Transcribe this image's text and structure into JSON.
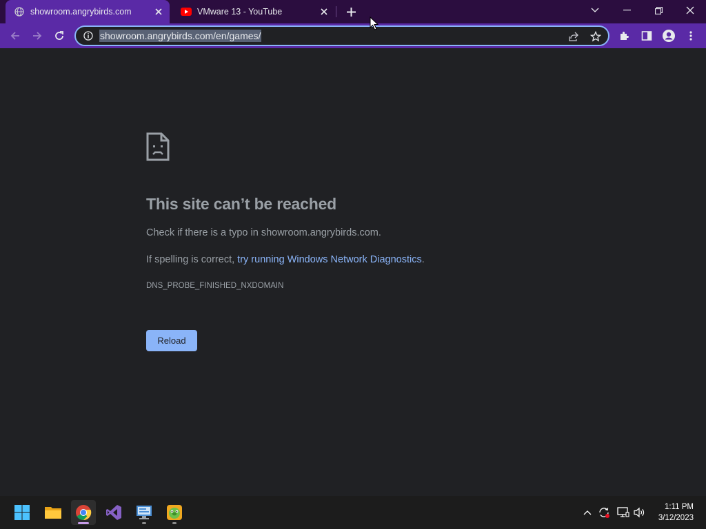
{
  "browser": {
    "tabs": [
      {
        "title": "showroom.angrybirds.com",
        "favicon": "globe-icon",
        "active": true
      },
      {
        "title": "VMware 13 - YouTube",
        "favicon": "youtube-icon",
        "active": false
      }
    ],
    "new_tab_icon": "plus-icon",
    "window_controls": [
      "tab-search-icon",
      "minimize-icon",
      "restore-icon",
      "close-icon"
    ],
    "toolbar": {
      "back_icon": "back-arrow-icon",
      "forward_icon": "forward-arrow-icon",
      "reload_icon": "reload-icon",
      "url": "showroom.angrybirds.com/en/games/",
      "site_info_icon": "info-icon",
      "share_icon": "share-icon",
      "bookmark_icon": "star-icon",
      "extensions_icon": "puzzle-icon",
      "side_panel_icon": "side-panel-icon",
      "profile_icon": "profile-icon",
      "menu_icon": "kebab-menu-icon"
    },
    "accent_color": "#5a2aa6"
  },
  "error_page": {
    "icon": "sad-document-icon",
    "title": "This site can’t be reached",
    "line1": "Check if there is a typo in showroom.angrybirds.com.",
    "line2_prefix": "If spelling is correct, ",
    "line2_link": "try running Windows Network Diagnostics",
    "line2_suffix": ".",
    "error_code": "DNS_PROBE_FINISHED_NXDOMAIN",
    "reload_label": "Reload",
    "link_color": "#8ab4f8"
  },
  "taskbar": {
    "apps": [
      {
        "name": "start-icon"
      },
      {
        "name": "file-explorer-icon"
      },
      {
        "name": "chrome-icon",
        "active": true
      },
      {
        "name": "visual-studio-icon"
      },
      {
        "name": "remote-desktop-icon",
        "running": true
      },
      {
        "name": "angry-birds-icon",
        "running": true
      }
    ],
    "tray": [
      "chevron-up-icon",
      "sync-icon",
      "network-icon",
      "volume-icon"
    ],
    "time": "1:11 PM",
    "date": "3/12/2023"
  }
}
